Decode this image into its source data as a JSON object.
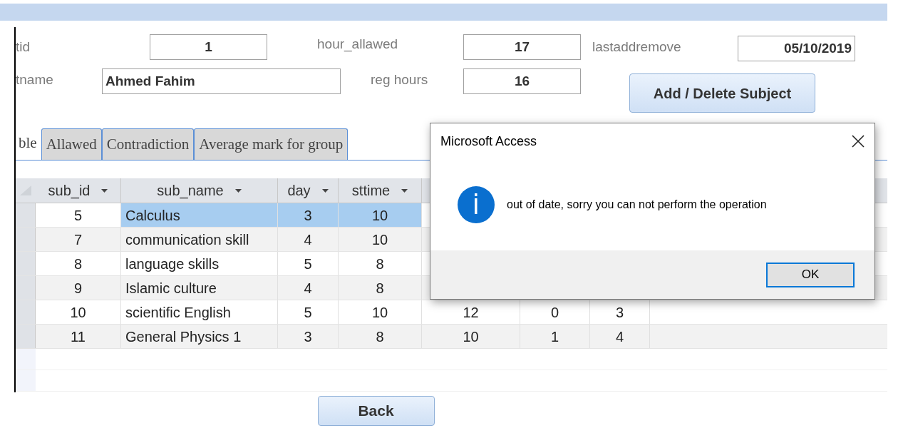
{
  "form": {
    "row_1": [
      {
        "label": "tid",
        "value": "1"
      },
      {
        "label": "hour_allawed",
        "value": "17"
      },
      {
        "label": "lastaddremove",
        "value": "05/10/2019"
      }
    ],
    "row_2": [
      {
        "label": "tname",
        "value": "Ahmed Fahim"
      },
      {
        "label": "reg hours",
        "value": "16"
      }
    ],
    "action_button": "Add / Delete Subject"
  },
  "tabs": [
    {
      "label": "ble",
      "selected": true
    },
    {
      "label": "Allawed",
      "selected": false
    },
    {
      "label": "Contradiction",
      "selected": false
    },
    {
      "label": "Average mark for group",
      "selected": false
    }
  ],
  "table": {
    "columns": [
      "sub_id",
      "sub_name",
      "day",
      "sttime"
    ],
    "rows": [
      {
        "selected": true,
        "cells": [
          "5",
          "Calculus",
          "3",
          "10"
        ]
      },
      {
        "selected": false,
        "cells": [
          "7",
          "communication skill",
          "4",
          "10"
        ]
      },
      {
        "selected": false,
        "cells": [
          "8",
          "language skills",
          "5",
          "8"
        ]
      },
      {
        "selected": false,
        "cells": [
          "9",
          "Islamic culture",
          "4",
          "8"
        ]
      },
      {
        "selected": false,
        "cells": [
          "10",
          "scientific English",
          "5",
          "10",
          "12",
          "0",
          "3"
        ]
      },
      {
        "selected": false,
        "cells": [
          "11",
          "General Physics 1",
          "3",
          "8",
          "10",
          "1",
          "4"
        ]
      }
    ]
  },
  "back_button": "Back",
  "dialog": {
    "title": "Microsoft Access",
    "message": "out of date, sorry you can not perform the operation",
    "button": "OK"
  }
}
